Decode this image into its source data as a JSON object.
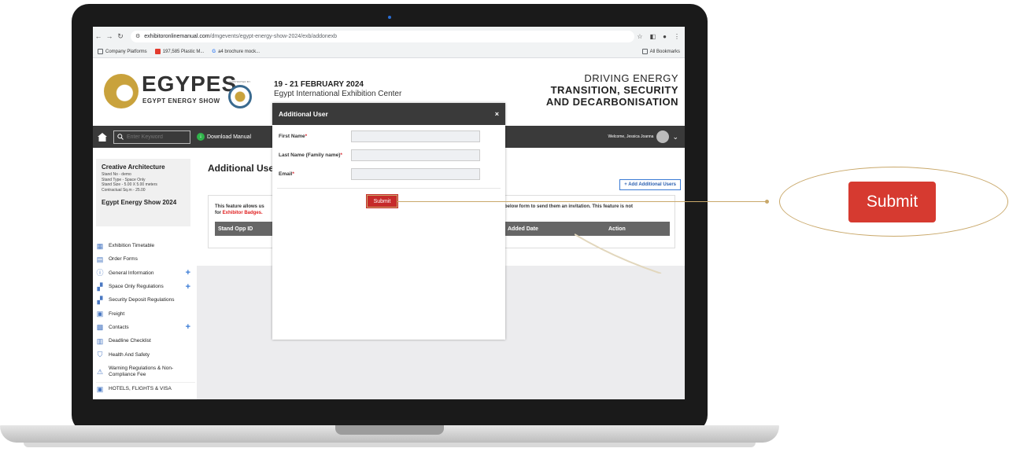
{
  "browser": {
    "url_domain": "exhibitoronlinemanual.com",
    "url_path": "/dmgevents/egypt-energy-show-2024/exb/addonexb",
    "bookmarks": [
      {
        "label": "Company Platforms",
        "color": "#5f6368"
      },
      {
        "label": "197,585 Plastic M...",
        "color": "#e33b2e"
      },
      {
        "label": "a4 brochure mock...",
        "color": "#4285f4"
      }
    ],
    "all_bookmarks": "All Bookmarks"
  },
  "header": {
    "logo_title": "EGYPES",
    "logo_subtitle": "EGYPT ENERGY SHOW",
    "event_date": "19 - 21 FEBRUARY 2024",
    "event_venue": "Egypt International Exhibition Center",
    "tagline_1": "DRIVING ENERGY",
    "tagline_2": "TRANSITION, SECURITY",
    "tagline_3": "AND DECARBONISATION",
    "brand_color": "#c9a23c"
  },
  "navbar": {
    "search_placeholder": "Enter Keyword",
    "download_label": "Download Manual",
    "welcome": "Welcome, Jessica Joanna"
  },
  "sidebar": {
    "company": "Creative Architecture",
    "stand_no": "Stand No - demo",
    "stand_type": "Stand Type - Space Only",
    "stand_size": "Stand Size - 5.00 X 5.00 meters",
    "contractual": "Contractual Sq.m - 25.00",
    "event": "Egypt Energy Show 2024",
    "items": [
      {
        "label": "Exhibition Timetable",
        "icon": "calendar-icon",
        "plus": ""
      },
      {
        "label": "Order Forms",
        "icon": "form-icon",
        "plus": ""
      },
      {
        "label": "General Information",
        "icon": "info-icon",
        "plus": "+"
      },
      {
        "label": "Space Only Regulations",
        "icon": "regulations-icon",
        "plus": "+"
      },
      {
        "label": "Security Deposit Regulations",
        "icon": "deposit-icon",
        "plus": ""
      },
      {
        "label": "Freight",
        "icon": "freight-icon",
        "plus": ""
      },
      {
        "label": "Contacts",
        "icon": "contacts-icon",
        "plus": "+"
      },
      {
        "label": "Deadline Checklist",
        "icon": "checklist-icon",
        "plus": ""
      },
      {
        "label": "Health And Safety",
        "icon": "shield-icon",
        "plus": ""
      },
      {
        "label": "Warning Regulations & Non-Compliance Fee",
        "icon": "warning-icon",
        "plus": ""
      },
      {
        "label": "HOTELS, FLIGHTS & VISA",
        "icon": "hotel-icon",
        "plus": ""
      }
    ]
  },
  "main": {
    "title": "Additional Users",
    "add_button": "+ Add Additional Users",
    "info_left_1": "This feature allows us",
    "info_left_2_prefix": "for",
    "info_left_2_red": "Exhibitor Badges.",
    "info_right": "below form to send them an invitation. This feature is not",
    "columns": [
      "Stand Opp ID",
      "Added Date",
      "Action"
    ]
  },
  "modal": {
    "title": "Additional User",
    "close": "×",
    "first_name_label": "First Name",
    "last_name_label": "Last Name (Family name)",
    "email_label": "Email",
    "required_mark": "*",
    "first_name_value": "",
    "last_name_value": "",
    "email_value": "",
    "submit_label": "Submit"
  },
  "callout": {
    "label": "Submit"
  },
  "colors": {
    "submit_red": "#c62a2a",
    "callout_gold": "#c9a86a"
  }
}
